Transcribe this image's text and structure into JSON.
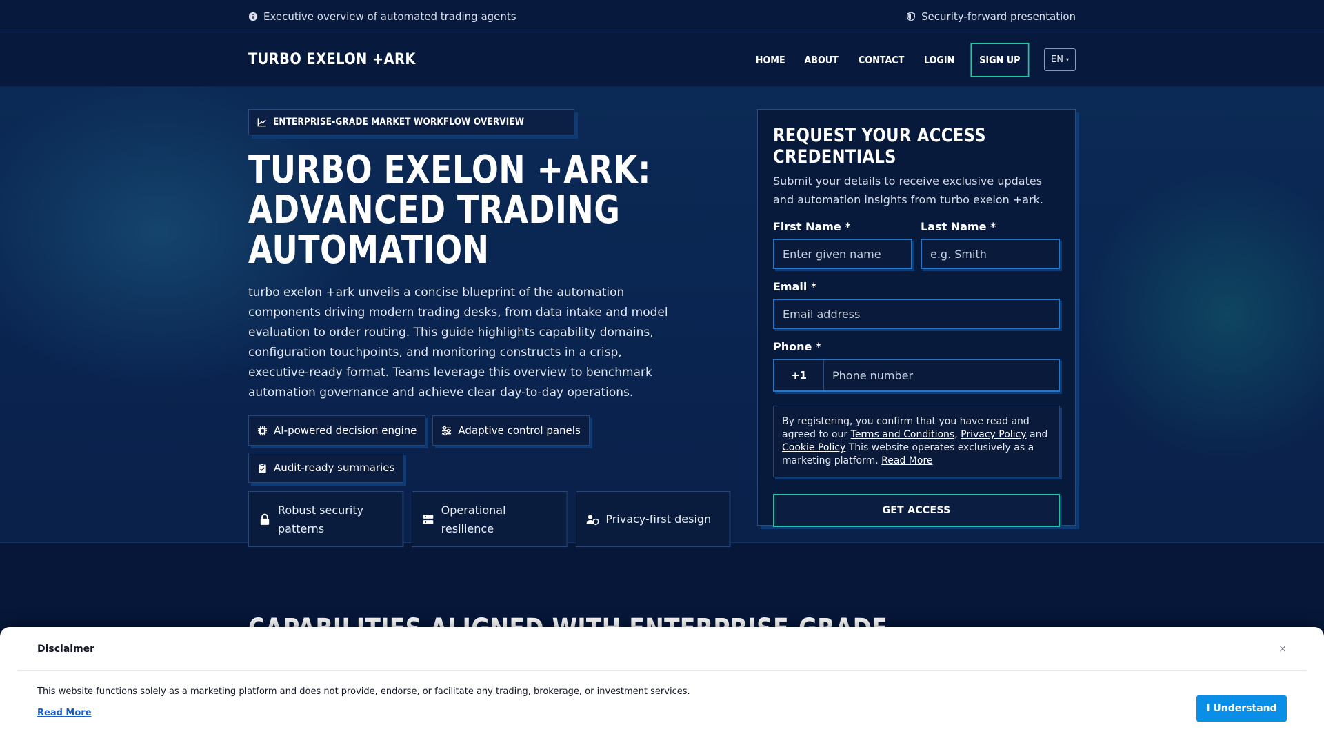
{
  "topbar": {
    "left_text": "Executive overview of automated trading agents",
    "right_text": "Security-forward presentation"
  },
  "nav": {
    "brand": "TURBO EXELON +ARK",
    "links": [
      "HOME",
      "ABOUT",
      "CONTACT",
      "LOGIN"
    ],
    "signup": "SIGN UP",
    "language": "EN"
  },
  "hero": {
    "tagline": "ENTERPRISE-GRADE MARKET WORKFLOW OVERVIEW",
    "title": "TURBO EXELON +ARK: ADVANCED TRADING AUTOMATION",
    "lead": "turbo exelon +ark unveils a concise blueprint of the automation components driving modern trading desks, from data intake and model evaluation to order routing. This guide highlights capability domains, configuration touchpoints, and monitoring constructs in a crisp, executive-ready format. Teams leverage this overview to benchmark automation governance and achieve clear day-to-day operations.",
    "chips": [
      "AI-powered decision engine",
      "Adaptive control panels",
      "Audit-ready summaries"
    ],
    "features": [
      "Robust security patterns",
      "Operational resilience",
      "Privacy-first design"
    ]
  },
  "form": {
    "title": "REQUEST YOUR ACCESS CREDENTIALS",
    "subtitle": "Submit your details to receive exclusive updates and automation insights from turbo exelon +ark.",
    "first_name_label": "First Name *",
    "first_name_placeholder": "Enter given name",
    "last_name_label": "Last Name *",
    "last_name_placeholder": "e.g. Smith",
    "email_label": "Email *",
    "email_placeholder": "Email address",
    "phone_label": "Phone *",
    "phone_code": "+1",
    "phone_placeholder": "Phone number",
    "consent_prefix": "By registering, you confirm that you have read and agreed to our ",
    "terms": "Terms and Conditions",
    "comma": ", ",
    "privacy": "Privacy Policy",
    "and": " and ",
    "cookie": "Cookie Policy",
    "consent_suffix": " This website operates exclusively as a marketing platform. ",
    "read_more": "Read More",
    "cta": "GET ACCESS"
  },
  "section": {
    "heading": "CAPABILITIES ALIGNED WITH ENTERPRISE-GRADE"
  },
  "disclaimer": {
    "title": "Disclaimer",
    "close": "×",
    "text": "This website functions solely as a marketing platform and does not provide, endorse, or facilitate any trading, brokerage, or investment services.",
    "read_more": "Read More",
    "button": "I Understand"
  },
  "colors": {
    "accent_teal": "#20c7a1",
    "input_border": "#2577c9",
    "background": "#06173a",
    "disclaimer_button": "#0a8fe8"
  }
}
